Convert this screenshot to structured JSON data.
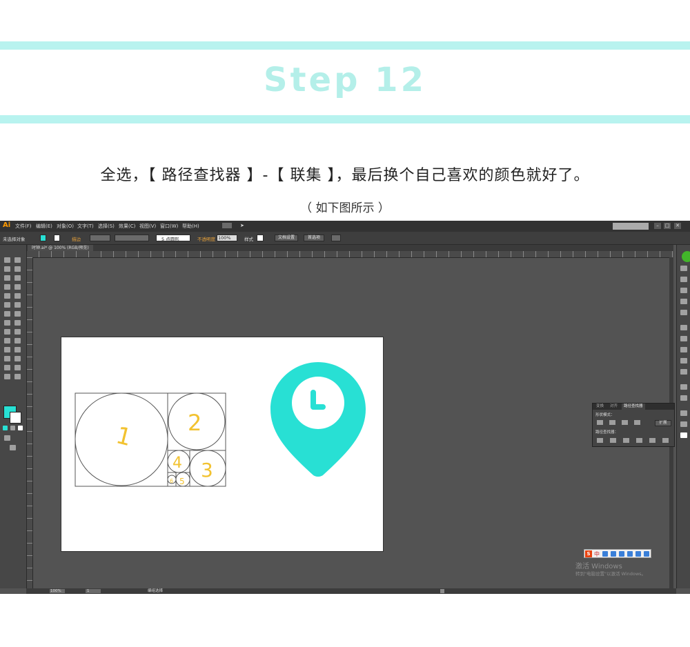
{
  "header": {
    "step_title": "Step 12",
    "instruction": "全选，【 路径查找器 】-【 联集 】，最后换个自己喜欢的颜色就好了。",
    "subtitle": "（ 如下图所示 ）",
    "accent_color": "#b8f3ef"
  },
  "app": {
    "logo": "Ai",
    "menus": [
      "文件(F)",
      "编辑(E)",
      "对象(O)",
      "文字(T)",
      "选择(S)",
      "效果(C)",
      "视图(V)",
      "窗口(W)",
      "帮助(H)"
    ],
    "control_bar": {
      "selection_label": "未选择对象",
      "stroke_label": "描边",
      "brush_label": "5 点圆形",
      "opacity_label": "不透明度",
      "opacity_value": "100%",
      "style_label": "样式",
      "doc_setup_button": "文档设置",
      "preferences_button": "首选项"
    },
    "document_tab": "时钟.ai* @ 100% (RGB/预览)",
    "fill_color": "#28e0d4",
    "status": {
      "zoom": "100%",
      "artboard_number": "1",
      "tool_name": "编组选择"
    },
    "panel": {
      "tabs": [
        "变换",
        "对齐",
        "路径查找器"
      ],
      "shape_modes_label": "形状模式：",
      "expand_button": "扩展",
      "pathfinder_label": "路径查找器："
    },
    "windows_activation": {
      "title": "激活 Windows",
      "subtitle": "转到\"电脑设置\"以激活 Windows。"
    },
    "ime_logo": "S",
    "ime_mode": "中"
  },
  "artwork": {
    "golden_ratio_labels": [
      "1",
      "2",
      "3",
      "4",
      "5",
      "6"
    ],
    "pin_color": "#28e0d4",
    "label_color": "#f2c230"
  }
}
